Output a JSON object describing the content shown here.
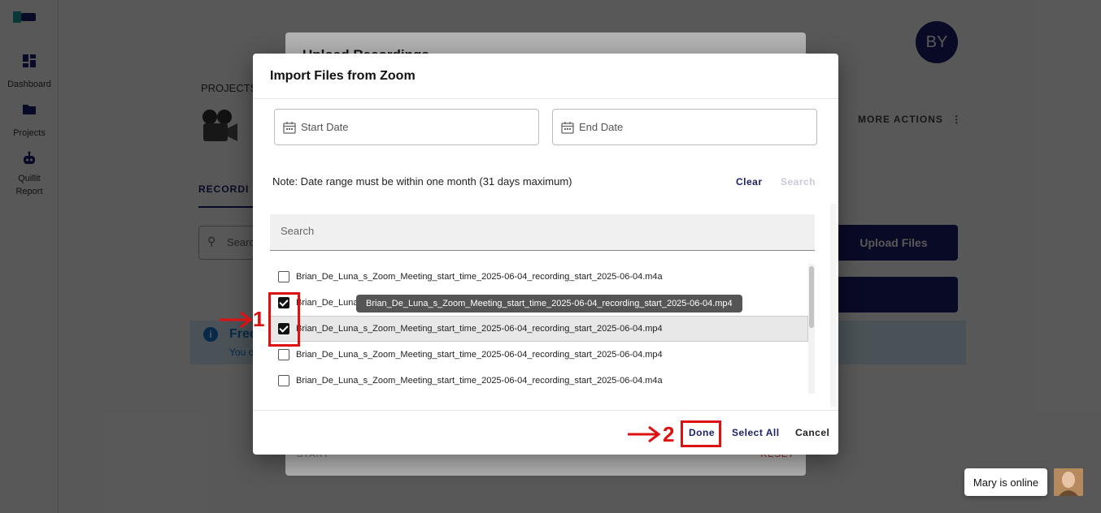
{
  "sidebar": {
    "items": [
      {
        "label": "Dashboard",
        "icon": "dashboard-icon"
      },
      {
        "label": "Projects",
        "icon": "folder-icon"
      },
      {
        "label": "Quillit Report",
        "icon": "robot-icon"
      }
    ]
  },
  "background": {
    "avatar_initials": "BY",
    "projects_label": "PROJECTS",
    "more_actions_label": "MORE ACTIONS",
    "recordings_tab": "RECORDI",
    "search_placeholder": "Searc",
    "upload_files_label": "Upload Files",
    "banner_title": "Free",
    "banner_text": "You c",
    "back_modal_title": "Upload Recordings",
    "back_modal_start": "START",
    "back_modal_reset": "RESET"
  },
  "modal": {
    "title": "Import Files from Zoom",
    "start_date_placeholder": "Start Date",
    "end_date_placeholder": "End Date",
    "note": "Note: Date range must be within one month (31 days maximum)",
    "clear_label": "Clear",
    "search_label": "Search",
    "search_placeholder": "Search",
    "files": [
      {
        "name": "Brian_De_Luna_s_Zoom_Meeting_start_time_2025-06-04_recording_start_2025-06-04.m4a",
        "checked": false
      },
      {
        "name": "Brian_De_Luna",
        "checked": true
      },
      {
        "name": "Brian_De_Luna_s_Zoom_Meeting_start_time_2025-06-04_recording_start_2025-06-04.mp4",
        "checked": true
      },
      {
        "name": "Brian_De_Luna_s_Zoom_Meeting_start_time_2025-06-04_recording_start_2025-06-04.mp4",
        "checked": false
      },
      {
        "name": "Brian_De_Luna_s_Zoom_Meeting_start_time_2025-06-04_recording_start_2025-06-04.m4a",
        "checked": false
      }
    ],
    "tooltip": "Brian_De_Luna_s_Zoom_Meeting_start_time_2025-06-04_recording_start_2025-06-04.mp4",
    "done_label": "Done",
    "select_all_label": "Select All",
    "cancel_label": "Cancel"
  },
  "annotations": {
    "step1": "1",
    "step2": "2",
    "color": "#dd1111"
  },
  "chat": {
    "status": "Mary is online"
  },
  "colors": {
    "primary": "#1b1f6b",
    "info": "#1976d2"
  }
}
